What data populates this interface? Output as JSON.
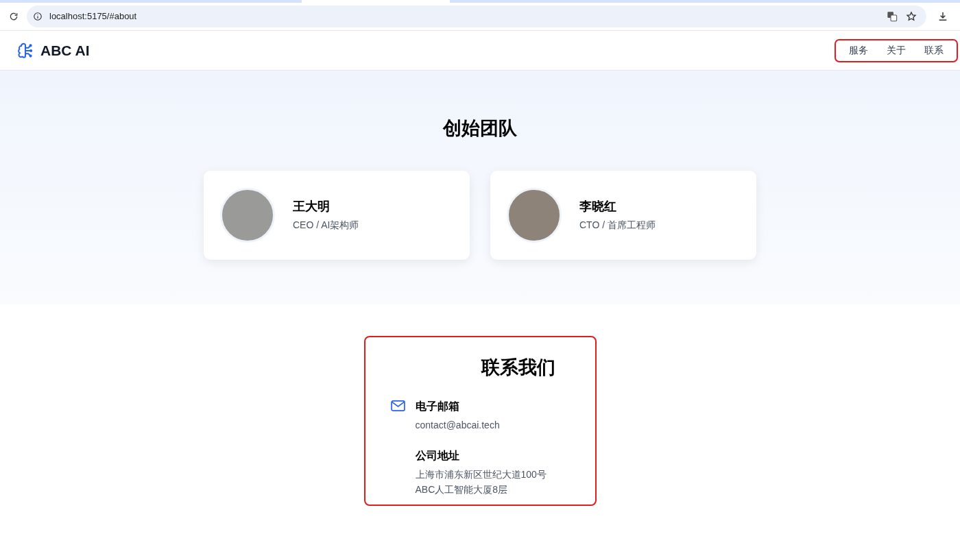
{
  "browser": {
    "url": "localhost:5175/#about"
  },
  "header": {
    "brand": "ABC AI",
    "nav": [
      "服务",
      "关于",
      "联系"
    ],
    "nav_highlighted": true
  },
  "team": {
    "title": "创始团队",
    "members": [
      {
        "name": "王大明",
        "role": "CEO / AI架构师"
      },
      {
        "name": "李晓红",
        "role": "CTO / 首席工程师"
      }
    ]
  },
  "contact": {
    "title": "联系我们",
    "highlighted": true,
    "items": [
      {
        "kind": "email",
        "label": "电子邮箱",
        "lines": [
          "contact@abcai.tech"
        ]
      },
      {
        "kind": "address",
        "label": "公司地址",
        "lines": [
          "上海市浦东新区世纪大道100号",
          "ABC人工智能大厦8层"
        ]
      }
    ]
  }
}
